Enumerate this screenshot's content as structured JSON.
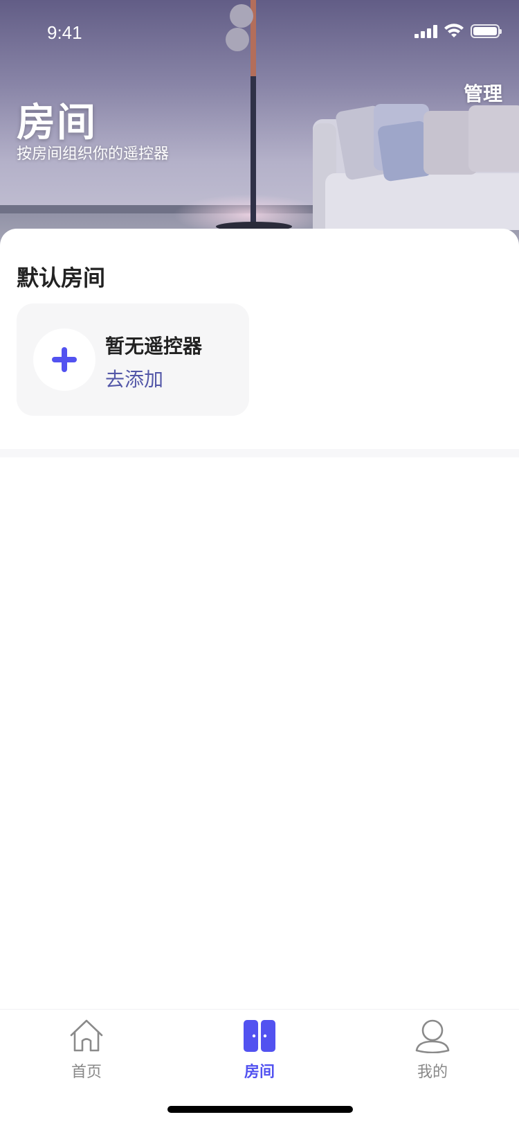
{
  "status_bar": {
    "time": "9:41"
  },
  "header": {
    "title": "房间",
    "subtitle": "按房间组织你的遥控器",
    "manage_label": "管理"
  },
  "section": {
    "title": "默认房间",
    "empty_card": {
      "title": "暂无遥控器",
      "action": "去添加",
      "icon": "plus-icon"
    }
  },
  "tabbar": {
    "items": [
      {
        "label": "首页",
        "icon": "home-icon",
        "active": false
      },
      {
        "label": "房间",
        "icon": "room-icon",
        "active": true
      },
      {
        "label": "我的",
        "icon": "profile-icon",
        "active": false
      }
    ]
  },
  "colors": {
    "accent": "#5252f0",
    "link": "#5357a8",
    "inactive": "#888888",
    "card_bg": "#f6f6f7"
  }
}
